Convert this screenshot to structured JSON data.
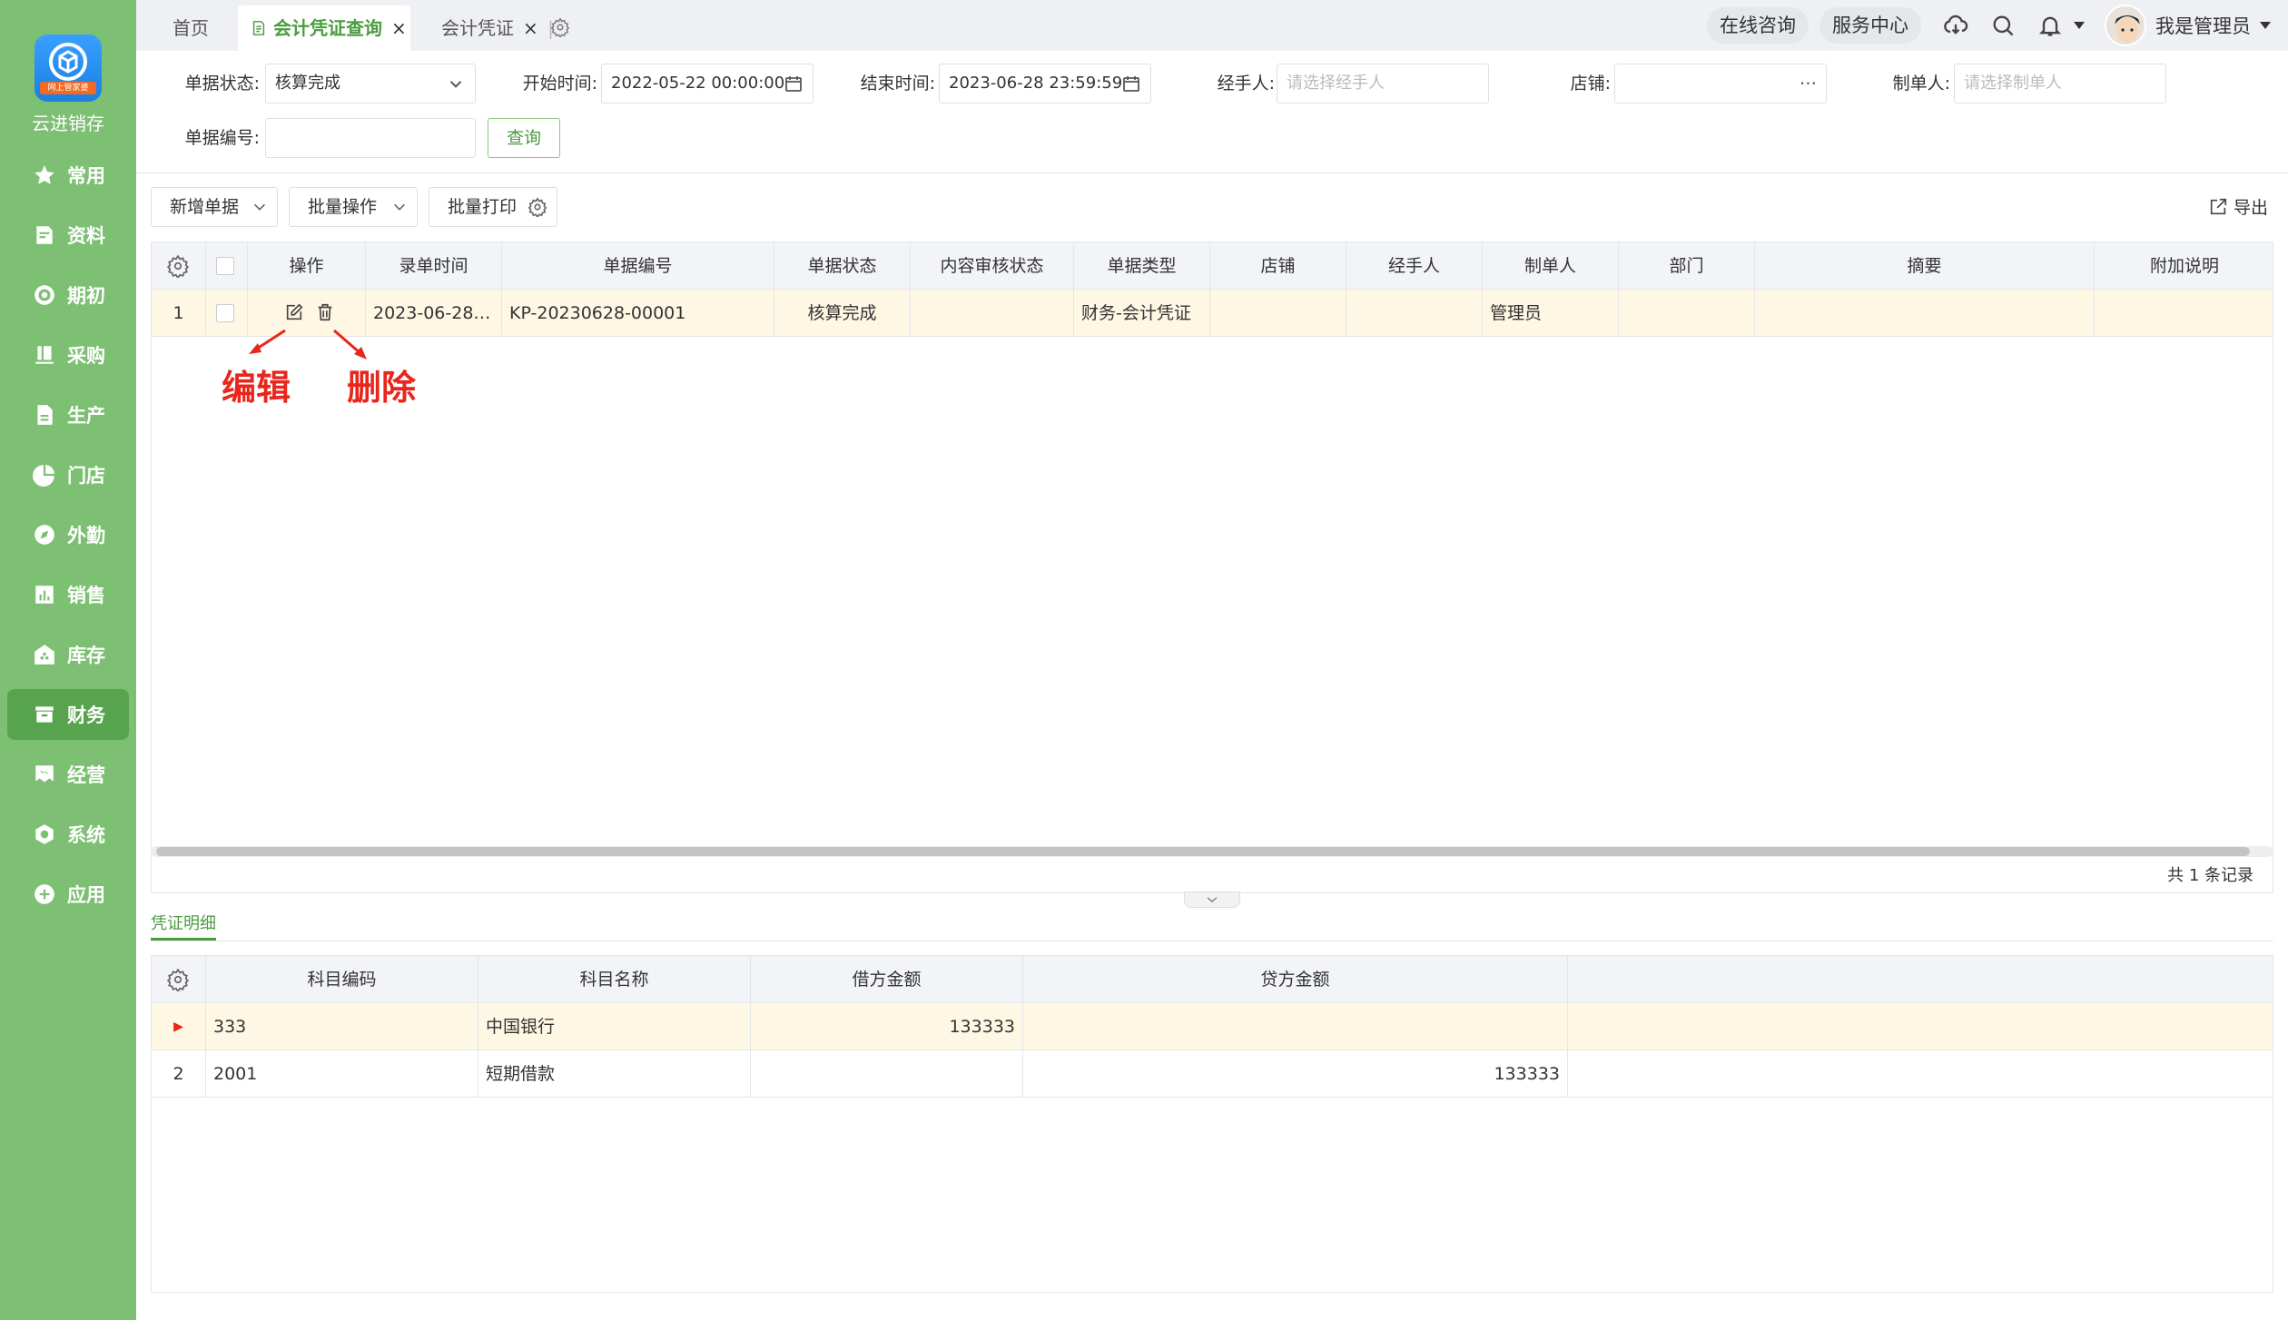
{
  "sidebar": {
    "brand": "云进销存",
    "logo_strip": "网上管家婆",
    "items": [
      {
        "label": "常用",
        "icon": "star-icon"
      },
      {
        "label": "资料",
        "icon": "doc-icon"
      },
      {
        "label": "期初",
        "icon": "target-icon"
      },
      {
        "label": "采购",
        "icon": "book-icon"
      },
      {
        "label": "生产",
        "icon": "file-icon"
      },
      {
        "label": "门店",
        "icon": "pie-icon"
      },
      {
        "label": "外勤",
        "icon": "compass-icon"
      },
      {
        "label": "销售",
        "icon": "chart-icon"
      },
      {
        "label": "库存",
        "icon": "warehouse-icon"
      },
      {
        "label": "财务",
        "icon": "wallet-icon"
      },
      {
        "label": "经营",
        "icon": "flag-icon"
      },
      {
        "label": "系统",
        "icon": "hex-icon"
      },
      {
        "label": "应用",
        "icon": "plus-icon"
      }
    ]
  },
  "tabs": {
    "home": "首页",
    "voucher_query": "会计凭证查询",
    "voucher": "会计凭证",
    "close": "×",
    "sep": "|"
  },
  "header": {
    "online": "在线咨询",
    "service": "服务中心",
    "user": "我是管理员"
  },
  "filters": {
    "status_label": "单据状态:",
    "status_value": "核算完成",
    "start_label": "开始时间:",
    "start_value": "2022-05-22 00:00:00",
    "end_label": "结束时间:",
    "end_value": "2023-06-28 23:59:59",
    "handler_label": "经手人:",
    "handler_ph": "请选择经手人",
    "shop_label": "店铺:",
    "shop_dots": "···",
    "maker_label": "制单人:",
    "maker_ph": "请选择制单人",
    "no_label": "单据编号:",
    "query": "查询"
  },
  "toolbar": {
    "new": "新增单据",
    "batch": "批量操作",
    "print": "批量打印",
    "export": "导出"
  },
  "main_table": {
    "headers": [
      "操作",
      "录单时间",
      "单据编号",
      "单据状态",
      "内容审核状态",
      "单据类型",
      "店铺",
      "经手人",
      "制单人",
      "部门",
      "摘要",
      "附加说明"
    ],
    "rows": [
      {
        "idx": "1",
        "time": "2023-06-28 1…",
        "no": "KP-20230628-00001",
        "status": "核算完成",
        "audit": "",
        "type": "财务-会计凭证",
        "shop": "",
        "handler": "",
        "maker": "管理员",
        "dept": "",
        "summary": "",
        "note": ""
      }
    ],
    "total": "共 1 条记录"
  },
  "annotations": {
    "edit": "编辑",
    "delete": "删除"
  },
  "detail": {
    "tab": "凭证明细",
    "headers": [
      "科目编码",
      "科目名称",
      "借方金额",
      "贷方金额"
    ],
    "rows": [
      {
        "idx": "▶",
        "code": "333",
        "name": "中国银行",
        "debit": "133333",
        "credit": ""
      },
      {
        "idx": "2",
        "code": "2001",
        "name": "短期借款",
        "debit": "",
        "credit": "133333"
      }
    ]
  },
  "colors": {
    "sidebar": "#7dbf73",
    "accent": "#4a9c3f",
    "annotation": "#e8261c",
    "highlight_row": "#fdf7e3"
  }
}
